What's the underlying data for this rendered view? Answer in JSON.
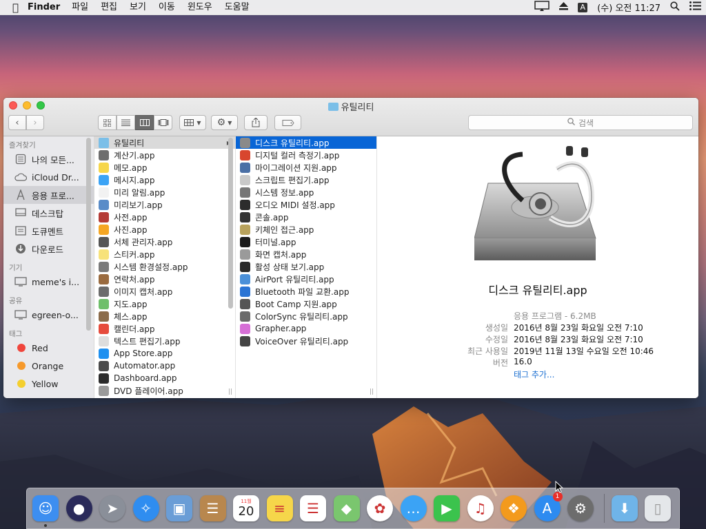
{
  "menubar": {
    "app": "Finder",
    "items": [
      "파일",
      "편집",
      "보기",
      "이동",
      "윈도우",
      "도움말"
    ],
    "ime": "A",
    "clock": "(수) 오전 11:27"
  },
  "window": {
    "title": "유틸리티",
    "search_placeholder": "검색"
  },
  "sidebar": {
    "sections": [
      {
        "header": "즐겨찾기",
        "items": [
          {
            "label": "나의 모든...",
            "icon": "all-files-icon"
          },
          {
            "label": "iCloud Dr...",
            "icon": "cloud-icon"
          },
          {
            "label": "응용 프로...",
            "icon": "applications-icon",
            "selected": true
          },
          {
            "label": "데스크탑",
            "icon": "desktop-icon"
          },
          {
            "label": "도큐멘트",
            "icon": "documents-icon"
          },
          {
            "label": "다운로드",
            "icon": "downloads-icon"
          }
        ]
      },
      {
        "header": "기기",
        "items": [
          {
            "label": "meme's i...",
            "icon": "computer-icon"
          }
        ]
      },
      {
        "header": "공유",
        "items": [
          {
            "label": "egreen-o...",
            "icon": "shared-computer-icon"
          }
        ]
      },
      {
        "header": "태그",
        "items": [
          {
            "label": "Red",
            "color": "#f0453c"
          },
          {
            "label": "Orange",
            "color": "#f6992b"
          },
          {
            "label": "Yellow",
            "color": "#f4cf2e"
          }
        ]
      }
    ]
  },
  "column1": [
    {
      "label": "유틸리티",
      "color": "#7bbfe8",
      "folder": true,
      "selected": true
    },
    {
      "label": "계산기.app",
      "color": "#6e6e6e"
    },
    {
      "label": "메모.app",
      "color": "#f6d64a"
    },
    {
      "label": "메시지.app",
      "color": "#3ba3f5"
    },
    {
      "label": "미리 알림.app",
      "color": "#f2f2f2"
    },
    {
      "label": "미리보기.app",
      "color": "#5a8cc8"
    },
    {
      "label": "사전.app",
      "color": "#b43b36"
    },
    {
      "label": "사진.app",
      "color": "#f5a623"
    },
    {
      "label": "서체 관리자.app",
      "color": "#555555"
    },
    {
      "label": "스티커.app",
      "color": "#f7e27a"
    },
    {
      "label": "시스템 환경설정.app",
      "color": "#7a7a7a"
    },
    {
      "label": "연락처.app",
      "color": "#9a6b3f"
    },
    {
      "label": "이미지 캡처.app",
      "color": "#6c6c6c"
    },
    {
      "label": "지도.app",
      "color": "#6fbf6a"
    },
    {
      "label": "체스.app",
      "color": "#8b6b4a"
    },
    {
      "label": "캘린더.app",
      "color": "#e64b3c"
    },
    {
      "label": "텍스트 편집기.app",
      "color": "#dddddd"
    },
    {
      "label": "App Store.app",
      "color": "#1e90f0"
    },
    {
      "label": "Automator.app",
      "color": "#4a4a4a"
    },
    {
      "label": "Dashboard.app",
      "color": "#2b2b2b"
    },
    {
      "label": "DVD 플레이어.app",
      "color": "#9a9a9a"
    }
  ],
  "column2": [
    {
      "label": "디스크 유틸리티.app",
      "color": "#8a8a8a",
      "selected": true
    },
    {
      "label": "디지털 컬러 측정기.app",
      "color": "#d8462e"
    },
    {
      "label": "마이그레이션 지원.app",
      "color": "#4a6fa5"
    },
    {
      "label": "스크립트 편집기.app",
      "color": "#c9c9c9"
    },
    {
      "label": "시스템 정보.app",
      "color": "#777777"
    },
    {
      "label": "오디오 MIDI 설정.app",
      "color": "#2c2c2c"
    },
    {
      "label": "콘솔.app",
      "color": "#333333"
    },
    {
      "label": "키체인 접근.app",
      "color": "#b8a25c"
    },
    {
      "label": "터미널.app",
      "color": "#1c1c1c"
    },
    {
      "label": "화면 캡처.app",
      "color": "#9a9a9a"
    },
    {
      "label": "활성 상태 보기.app",
      "color": "#2b2b2b"
    },
    {
      "label": "AirPort 유틸리티.app",
      "color": "#4a90d9"
    },
    {
      "label": "Bluetooth 파일 교환.app",
      "color": "#2a74d4"
    },
    {
      "label": "Boot Camp 지원.app",
      "color": "#555555"
    },
    {
      "label": "ColorSync 유틸리티.app",
      "color": "#6a6a6a"
    },
    {
      "label": "Grapher.app",
      "color": "#d66fd6"
    },
    {
      "label": "VoiceOver 유틸리티.app",
      "color": "#444444"
    }
  ],
  "preview": {
    "name": "디스크 유틸리티.app",
    "kind": "응용 프로그램 - 6.2MB",
    "created_label": "생성일",
    "created": "2016년 8월 23일 화요일 오전 7:10",
    "modified_label": "수정일",
    "modified": "2016년 8월 23일 화요일 오전 7:10",
    "opened_label": "최근 사용일",
    "opened": "2019년 11월 13일 수요일 오전 10:46",
    "version_label": "버전",
    "version": "16.0",
    "add_tags": "태그 추가..."
  },
  "dock": {
    "apps": [
      {
        "name": "finder-icon",
        "color": "#3d8ef0",
        "running": true
      },
      {
        "name": "siri-icon",
        "color": "#2a2a5a"
      },
      {
        "name": "launchpad-icon",
        "color": "#8a8f99"
      },
      {
        "name": "safari-icon",
        "color": "#2f8df0"
      },
      {
        "name": "preview-icon",
        "color": "#6a9dd6"
      },
      {
        "name": "contacts-icon",
        "color": "#b8874e"
      },
      {
        "name": "calendar-icon",
        "color": "#ffffff",
        "text": "20",
        "month": "11월"
      },
      {
        "name": "notes-icon",
        "color": "#f6d64a"
      },
      {
        "name": "reminders-icon",
        "color": "#ffffff"
      },
      {
        "name": "maps-icon",
        "color": "#7ac66e"
      },
      {
        "name": "photos-icon",
        "color": "#ffffff"
      },
      {
        "name": "messages-icon",
        "color": "#3ba3f5"
      },
      {
        "name": "facetime-icon",
        "color": "#3bc34d"
      },
      {
        "name": "itunes-icon",
        "color": "#ffffff"
      },
      {
        "name": "ibooks-icon",
        "color": "#f39a1d"
      },
      {
        "name": "app-store-icon",
        "color": "#2d8bf0",
        "badge": "1"
      },
      {
        "name": "system-preferences-icon",
        "color": "#6d6d6d"
      }
    ],
    "trailing": [
      {
        "name": "downloads-stack-icon",
        "color": "#6fb4e8"
      },
      {
        "name": "trash-icon",
        "color": "#e4e7ea"
      }
    ]
  }
}
